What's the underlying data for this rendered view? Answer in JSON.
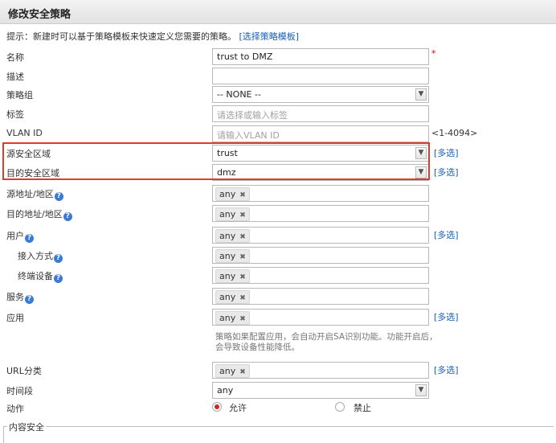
{
  "title": "修改安全策略",
  "hint": {
    "text": "提示：新建时可以基于策略模板来快速定义您需要的策略。",
    "link": "[选择策略模板]"
  },
  "multi_label": "[多选]",
  "fields": {
    "name": {
      "label": "名称",
      "value": "trust to  DMZ"
    },
    "desc": {
      "label": "描述",
      "value": ""
    },
    "group": {
      "label": "策略组",
      "value": "-- NONE --"
    },
    "tag": {
      "label": "标签",
      "placeholder": "请选择或输入标签"
    },
    "vlan": {
      "label": "VLAN ID",
      "placeholder": "请输入VLAN ID",
      "range": "<1-4094>"
    },
    "src_zone": {
      "label": "源安全区域",
      "value": "trust"
    },
    "dst_zone": {
      "label": "目的安全区域",
      "value": "dmz"
    },
    "src_addr": {
      "label": "源地址/地区",
      "tag": "any"
    },
    "dst_addr": {
      "label": "目的地址/地区",
      "tag": "any"
    },
    "user": {
      "label": "用户",
      "tag": "any"
    },
    "access": {
      "label": "接入方式",
      "tag": "any"
    },
    "device": {
      "label": "终端设备",
      "tag": "any"
    },
    "service": {
      "label": "服务",
      "tag": "any"
    },
    "app": {
      "label": "应用",
      "tag": "any",
      "note": "策略如果配置应用，会自动开启SA识别功能。功能开启后，会导致设备性能降低。"
    },
    "url": {
      "label": "URL分类",
      "tag": "any"
    },
    "time": {
      "label": "时间段",
      "value": "any"
    },
    "action": {
      "label": "动作",
      "allow": "允许",
      "deny": "禁止",
      "selected": "allow"
    }
  },
  "content_security": {
    "label": "内容安全"
  },
  "icons": {
    "help": "help-icon",
    "dropdown": "chevron-down-icon",
    "remove": "remove-tag-icon"
  },
  "colors": {
    "link": "#1a5fb4",
    "highlight": "#e03a2a",
    "required": "#ee0000",
    "radio_on": "#d9201a"
  }
}
